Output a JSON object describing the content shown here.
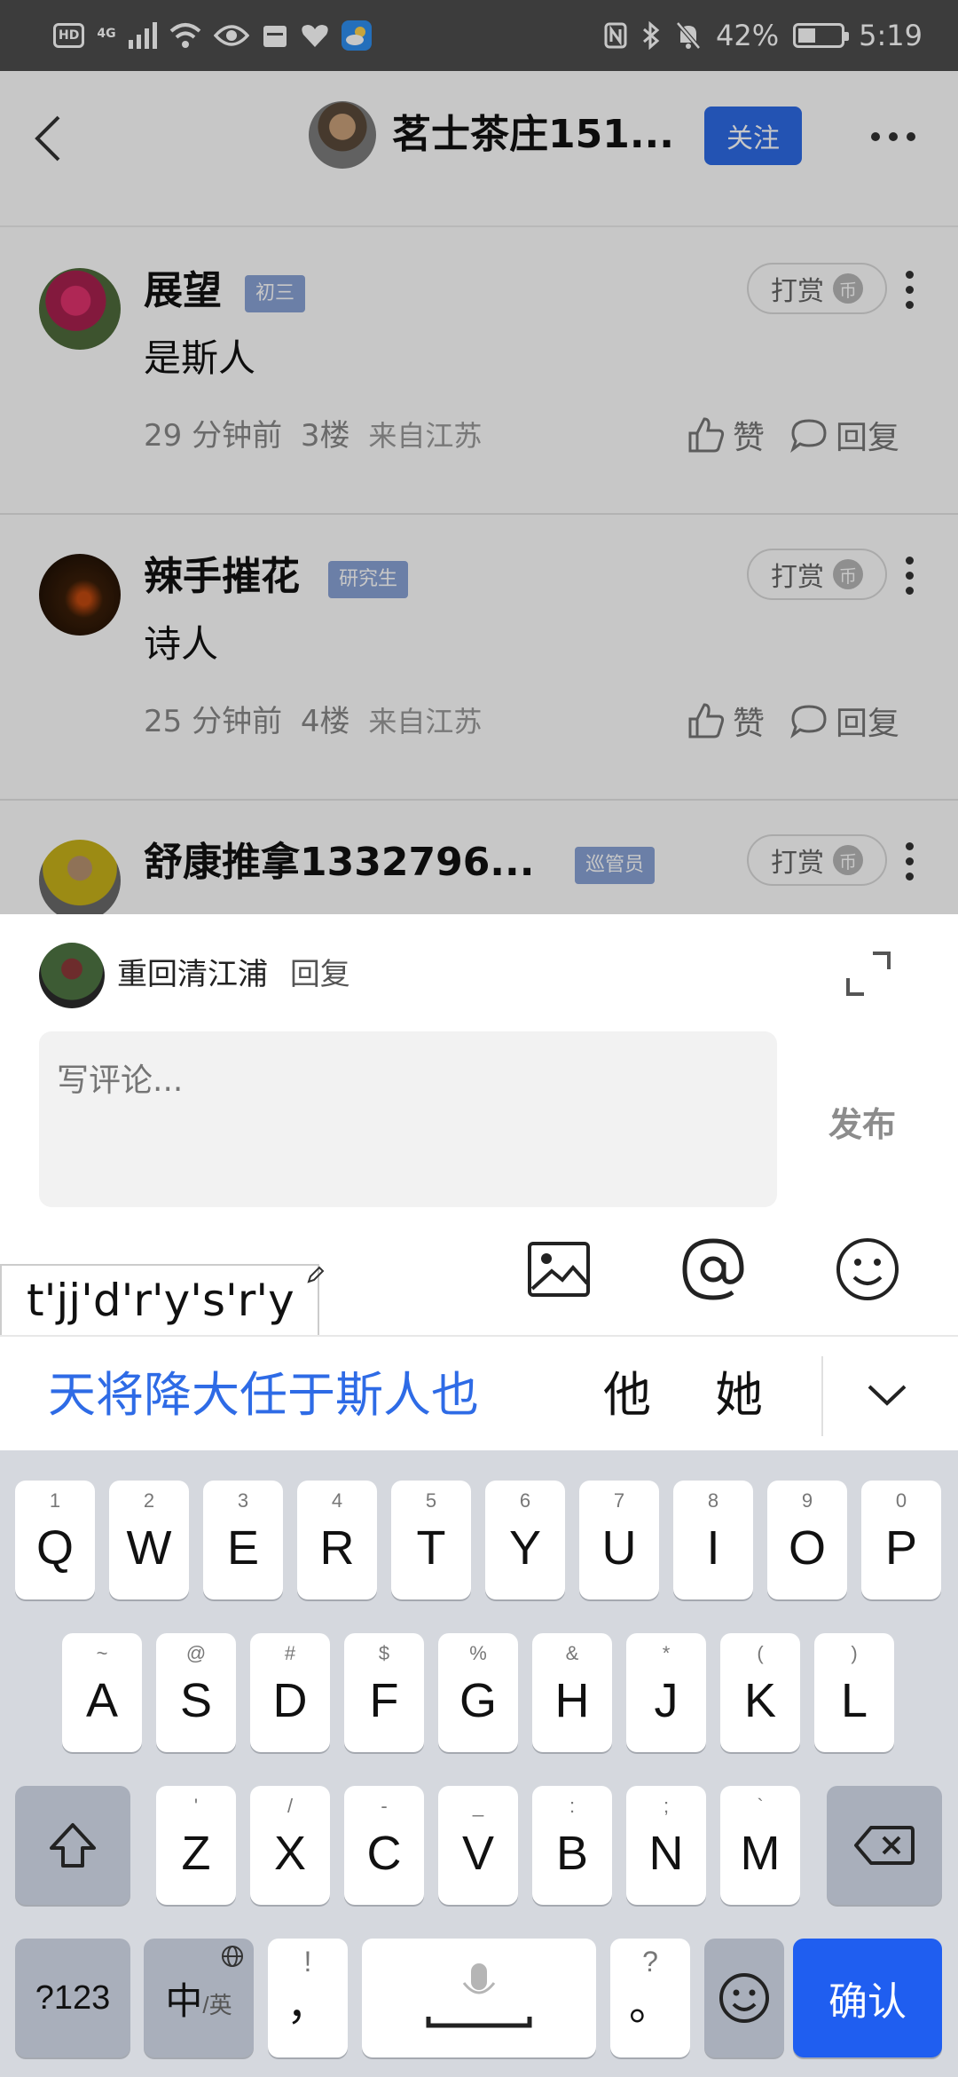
{
  "status_bar": {
    "hd": "HD",
    "network": "4G",
    "battery_percent": "42%",
    "battery_level": 0.42,
    "time": "5:19"
  },
  "header": {
    "title": "茗士茶庄151...",
    "follow_label": "关注"
  },
  "comments": [
    {
      "name": "展望",
      "badge": "初三",
      "reward_label": "打赏",
      "coin": "币",
      "text": "是斯人",
      "time": "29 分钟前",
      "floor": "3楼",
      "location": "来自江苏",
      "like_label": "赞",
      "reply_label": "回复"
    },
    {
      "name": "辣手摧花",
      "badge": "研究生",
      "reward_label": "打赏",
      "coin": "币",
      "text": "诗人",
      "time": "25 分钟前",
      "floor": "4楼",
      "location": "来自江苏",
      "like_label": "赞",
      "reply_label": "回复"
    },
    {
      "name": "舒康推拿1332796...",
      "badge": "巡管员",
      "reward_label": "打赏",
      "coin": "币"
    }
  ],
  "reply_sheet": {
    "target_name": "重回清江浦",
    "action": "回复",
    "placeholder": "写评论...",
    "publish_label": "发布",
    "preedit": "t'jj'd'r'y's'r'y"
  },
  "candidates": {
    "main": "天将降大任于斯人也",
    "alts": [
      "他",
      "她"
    ]
  },
  "keyboard": {
    "row1": [
      {
        "key": "Q",
        "sub": "1"
      },
      {
        "key": "W",
        "sub": "2"
      },
      {
        "key": "E",
        "sub": "3"
      },
      {
        "key": "R",
        "sub": "4"
      },
      {
        "key": "T",
        "sub": "5"
      },
      {
        "key": "Y",
        "sub": "6"
      },
      {
        "key": "U",
        "sub": "7"
      },
      {
        "key": "I",
        "sub": "8"
      },
      {
        "key": "O",
        "sub": "9"
      },
      {
        "key": "P",
        "sub": "0"
      }
    ],
    "row2": [
      {
        "key": "A",
        "sub": "~"
      },
      {
        "key": "S",
        "sub": "@"
      },
      {
        "key": "D",
        "sub": "#"
      },
      {
        "key": "F",
        "sub": "$"
      },
      {
        "key": "G",
        "sub": "%"
      },
      {
        "key": "H",
        "sub": "&"
      },
      {
        "key": "J",
        "sub": "*"
      },
      {
        "key": "K",
        "sub": "("
      },
      {
        "key": "L",
        "sub": ")"
      }
    ],
    "row3": [
      {
        "key": "Z",
        "sub": "'"
      },
      {
        "key": "X",
        "sub": "/"
      },
      {
        "key": "C",
        "sub": "-"
      },
      {
        "key": "V",
        "sub": "_"
      },
      {
        "key": "B",
        "sub": ":"
      },
      {
        "key": "N",
        "sub": ";"
      },
      {
        "key": "M",
        "sub": "`"
      }
    ],
    "numbers_label": "?123",
    "lang_main": "中",
    "lang_sub": "/英",
    "comma_label": "，",
    "comma_sub": "!",
    "period_label": "。",
    "period_sub": "?",
    "confirm_label": "确认"
  },
  "colors": {
    "accent": "#2e6be6",
    "badge": "#8aa3d6",
    "status_bar": "#4e4e4e",
    "keyboard_bg": "#d5d8de"
  }
}
